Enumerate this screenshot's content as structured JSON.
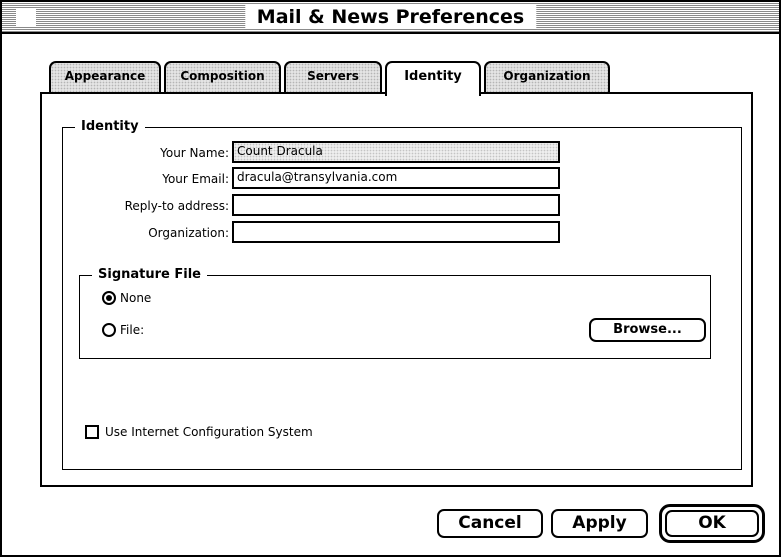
{
  "window": {
    "title": "Mail & News Preferences"
  },
  "tabs": [
    {
      "label": "Appearance",
      "active": false
    },
    {
      "label": "Composition",
      "active": false
    },
    {
      "label": "Servers",
      "active": false
    },
    {
      "label": "Identity",
      "active": true
    },
    {
      "label": "Organization",
      "active": false
    }
  ],
  "identity_group": {
    "title": "Identity",
    "fields": {
      "name": {
        "label": "Your Name:",
        "value": "Count Dracula"
      },
      "email": {
        "label": "Your Email:",
        "value": "dracula@transylvania.com"
      },
      "reply_to": {
        "label": "Reply-to address:",
        "value": ""
      },
      "organization": {
        "label": "Organization:",
        "value": ""
      }
    }
  },
  "signature_group": {
    "title": "Signature File",
    "options": [
      {
        "label": "None",
        "selected": true
      },
      {
        "label": "File:",
        "selected": false
      }
    ],
    "browse_label": "Browse..."
  },
  "checkbox": {
    "label": "Use Internet Configuration System",
    "checked": false
  },
  "buttons": {
    "cancel": "Cancel",
    "apply": "Apply",
    "ok": "OK"
  }
}
